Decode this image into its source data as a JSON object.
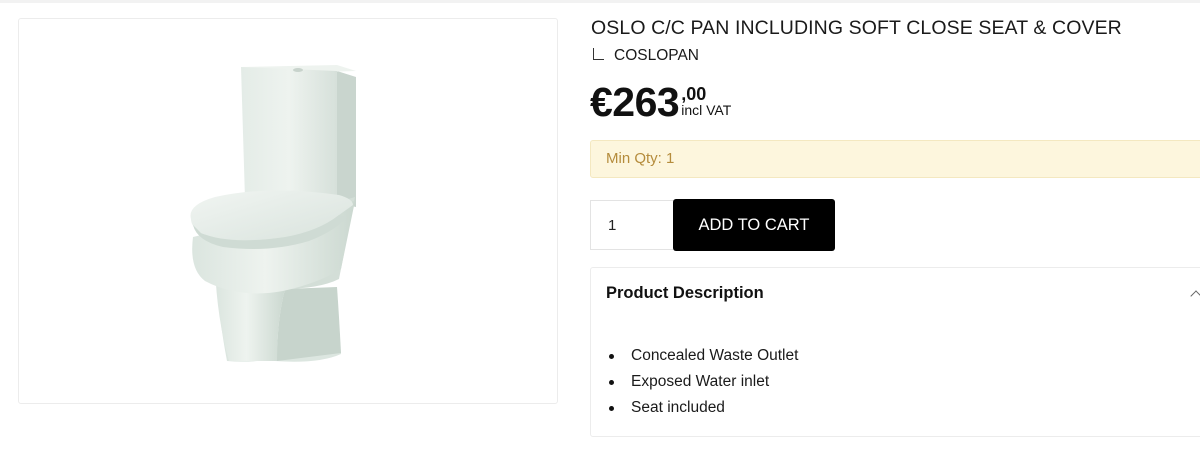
{
  "product": {
    "title": "OSLO C/C PAN INCLUDING SOFT CLOSE SEAT & COVER",
    "sku": "COSLOPAN",
    "image_icon": "toilet-product-image"
  },
  "price": {
    "main": "€263",
    "cents": ",00",
    "vat_label": "incl VAT"
  },
  "min_qty": {
    "text": "Min Qty: 1",
    "bg_color": "#fdf6dd",
    "text_color": "#b58c3c"
  },
  "cart": {
    "quantity_value": "1",
    "add_to_cart_label": "ADD TO CART",
    "button_color": "#000000"
  },
  "description": {
    "heading": "Product Description",
    "expanded": true,
    "items": [
      "Concealed Waste Outlet",
      "Exposed Water inlet",
      "Seat included"
    ]
  }
}
